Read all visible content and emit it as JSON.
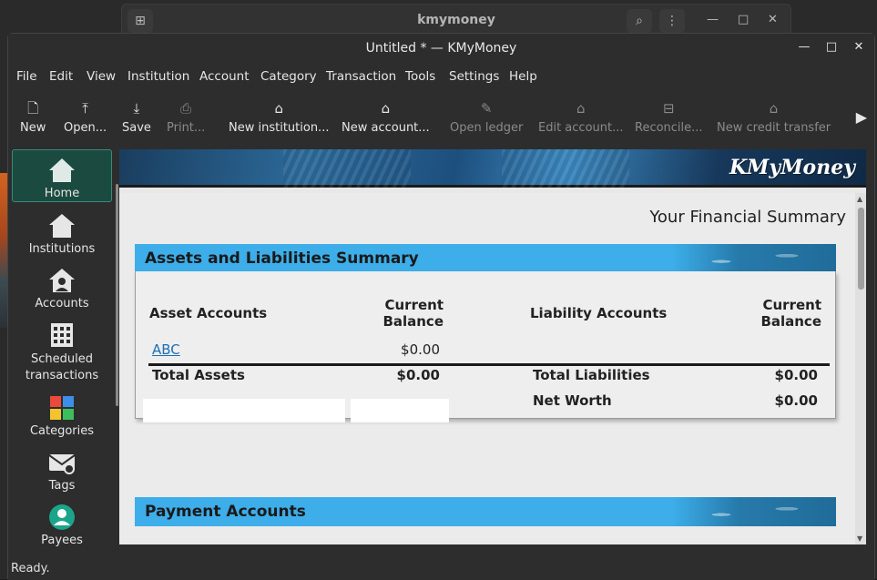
{
  "bg_window": {
    "title": "kmymoney"
  },
  "window": {
    "title": "Untitled * — KMyMoney"
  },
  "menu": [
    "File",
    "Edit",
    "View",
    "Institution",
    "Account",
    "Category",
    "Transaction",
    "Tools",
    "Settings",
    "Help"
  ],
  "toolbar": [
    {
      "label": "New",
      "icon": "new-file-icon",
      "enabled": true
    },
    {
      "label": "Open...",
      "icon": "open-upload-icon",
      "enabled": true
    },
    {
      "label": "Save",
      "icon": "save-download-icon",
      "enabled": true
    },
    {
      "label": "Print...",
      "icon": "printer-icon",
      "enabled": false
    },
    {
      "label": "New institution...",
      "icon": "new-institution-icon",
      "enabled": true
    },
    {
      "label": "New account...",
      "icon": "new-account-icon",
      "enabled": true
    },
    {
      "label": "Open ledger",
      "icon": "ledger-icon",
      "enabled": false
    },
    {
      "label": "Edit account...",
      "icon": "edit-account-icon",
      "enabled": false
    },
    {
      "label": "Reconcile...",
      "icon": "reconcile-icon",
      "enabled": false
    },
    {
      "label": "New credit transfer",
      "icon": "credit-transfer-icon",
      "enabled": false
    }
  ],
  "sidebar": [
    {
      "label": "Home",
      "icon": "home-icon",
      "selected": true
    },
    {
      "label": "Institutions",
      "icon": "institution-icon",
      "selected": false
    },
    {
      "label": "Accounts",
      "icon": "accounts-icon",
      "selected": false
    },
    {
      "label": "Scheduled\ntransactions",
      "icon": "calendar-icon",
      "selected": false
    },
    {
      "label": "Categories",
      "icon": "categories-icon",
      "selected": false
    },
    {
      "label": "Tags",
      "icon": "tags-icon",
      "selected": false
    },
    {
      "label": "Payees",
      "icon": "payees-icon",
      "selected": false
    }
  ],
  "logo": "KMyMoney",
  "home": {
    "title": "Your Financial Summary",
    "assets_section": "Assets and Liabilities Summary",
    "asset_header": "Asset Accounts",
    "current_balance_1": "Current",
    "current_balance_2": "Balance",
    "liability_header": "Liability Accounts",
    "asset_rows": [
      {
        "name": "ABC",
        "balance": "$0.00"
      }
    ],
    "total_assets_label": "Total Assets",
    "total_assets_value": "$0.00",
    "total_liabilities_label": "Total Liabilities",
    "total_liabilities_value": "$0.00",
    "net_worth_label": "Net Worth",
    "net_worth_value": "$0.00",
    "payment_section": "Payment Accounts"
  },
  "status": "Ready.",
  "colors": {
    "accent": "#3daee9",
    "selected_nav": "#1b4a40",
    "link": "#1d6fb5"
  }
}
